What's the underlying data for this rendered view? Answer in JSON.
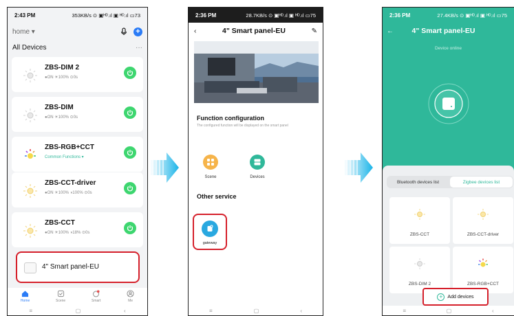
{
  "phone1": {
    "status": {
      "time": "2:43 PM",
      "right": "353KB/s ⊙ ▣ᴴᴰ.ıl ▣ ᴴᴰ.ıl ▭73"
    },
    "home_selector": "home ▾",
    "section_title": "All Devices",
    "more": "···",
    "devices": [
      {
        "name": "ZBS-DIM 2",
        "status": "●ON  ☀100%  ⊙0s"
      },
      {
        "name": "ZBS-DIM",
        "status": "●ON  ☀100%  ⊙0s"
      },
      {
        "name": "ZBS-RGB+CCT",
        "status": "Common Functions ▾"
      },
      {
        "name": "ZBS-CCT-driver",
        "status": "●ON  ☀100%  ◑100%  ⊙0s"
      },
      {
        "name": "ZBS-CCT",
        "status": "●ON  ☀100%  ◑18%  ⊙0s"
      }
    ],
    "panel_name": "4\" Smart panel-EU",
    "tabs": [
      "Home",
      "Scene",
      "Smart",
      "Me"
    ],
    "nav": [
      "≡",
      "▢",
      "‹"
    ]
  },
  "phone2": {
    "status": {
      "time": "2:36 PM",
      "right": "28.7KB/s ⊙ ▣ᴴᴰ.ıl ▣ ᴴᴰ.ıl ▭75"
    },
    "back": "‹",
    "title": "4\" Smart panel-EU",
    "edit": "✎",
    "function_title": "Function configuration",
    "function_sub": "The configured function will be displayed on the smart panel",
    "fn_scene": "Scene",
    "fn_devices": "Devices",
    "other_title": "Other service",
    "gateway": "gateway",
    "nav": [
      "≡",
      "▢",
      "‹"
    ]
  },
  "phone3": {
    "status": {
      "time": "2:36 PM",
      "right": "27.4KB/s ⊙ ▣ᴴᴰ.ıl ▣ ᴴᴰ.ıl ▭75"
    },
    "back": "←",
    "title": "4\" Smart panel-EU",
    "online": "Device online",
    "tab_bt": "Bluetooth devices list",
    "tab_zb": "Zigbee devices list",
    "devices": [
      "ZBS-CCT",
      "ZBS-CCT-driver",
      "ZBS-DIM 2",
      "ZBS-RGB+CCT"
    ],
    "add": "Add devices",
    "nav": [
      "≡",
      "▢",
      "‹"
    ]
  },
  "colors": {
    "accent_blue": "#2a7bf6",
    "teal": "#2fb89a",
    "power_green": "#3dd66f",
    "highlight_red": "#d51f2a",
    "arrow_cyan": "#1ab4e8"
  }
}
